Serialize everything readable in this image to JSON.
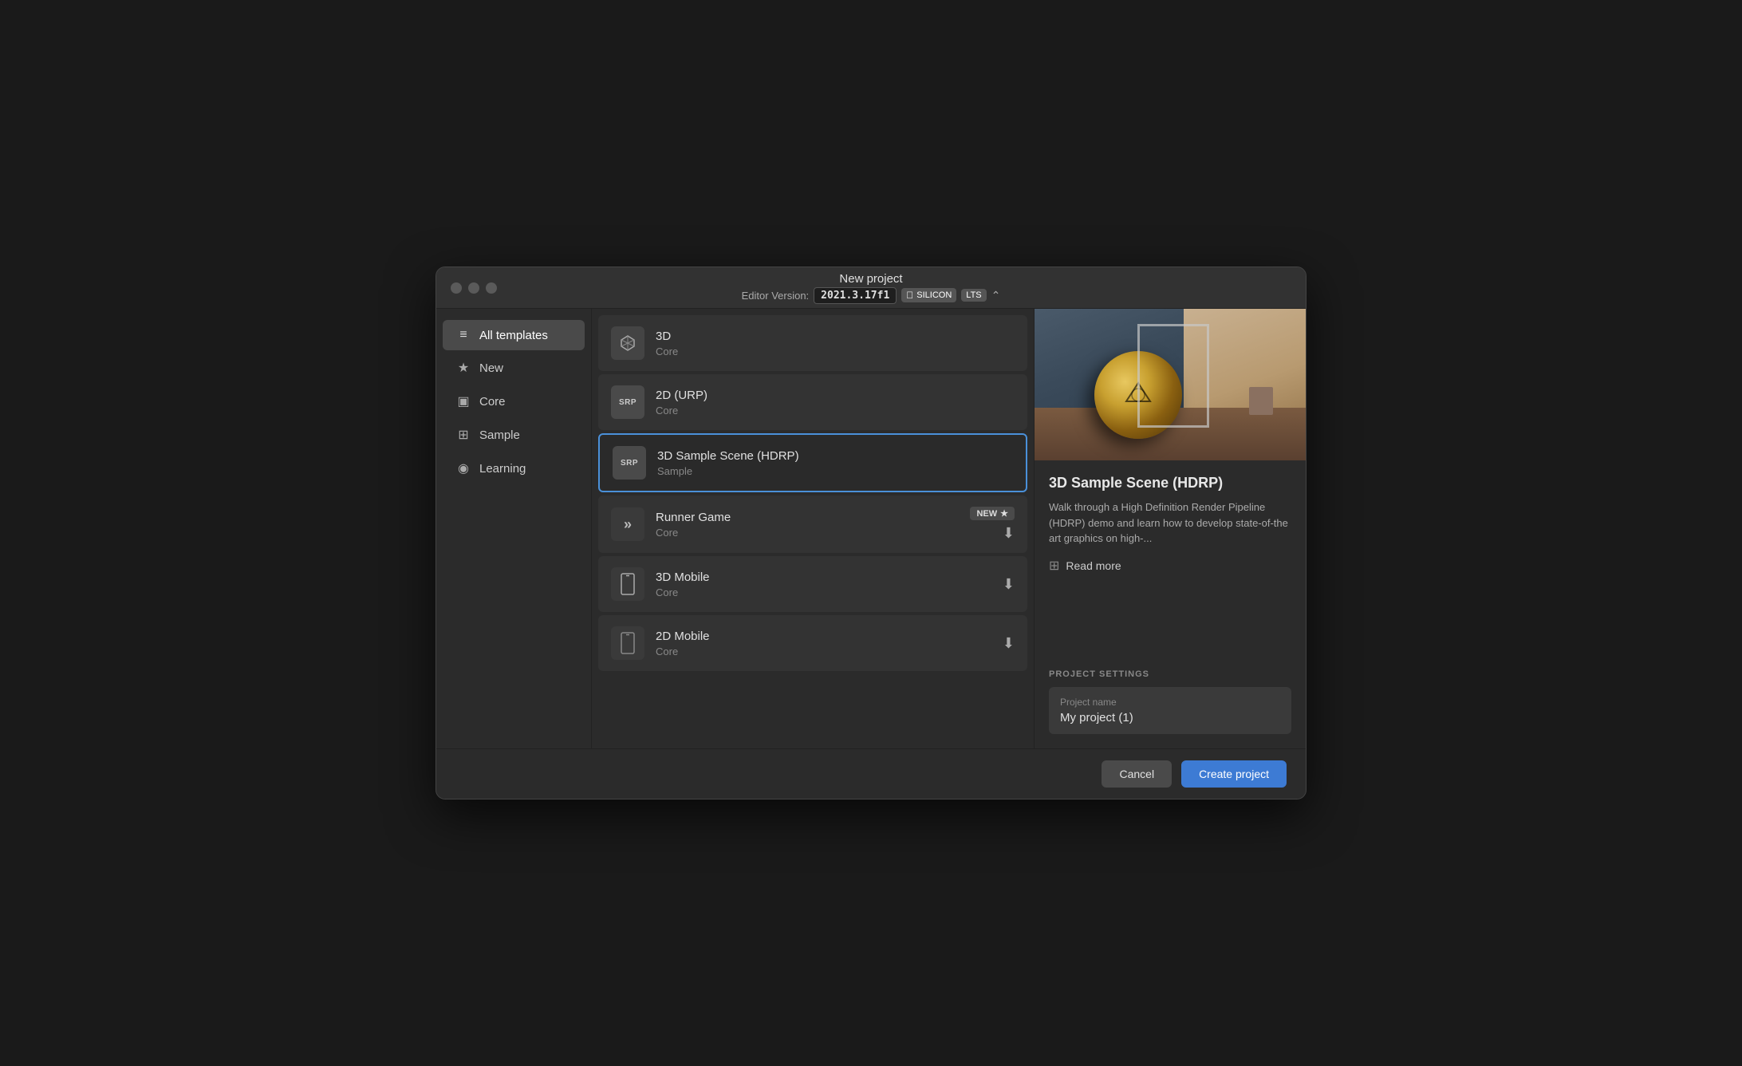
{
  "window": {
    "title": "New project"
  },
  "titlebar": {
    "title": "New project",
    "version_label": "Editor Version:",
    "version": "2021.3.17f1",
    "silicon": "SILICON",
    "lts": "LTS"
  },
  "sidebar": {
    "items": [
      {
        "id": "all-templates",
        "label": "All templates",
        "icon": "≡",
        "active": true
      },
      {
        "id": "new",
        "label": "New",
        "icon": "★"
      },
      {
        "id": "core",
        "label": "Core",
        "icon": "▣"
      },
      {
        "id": "sample",
        "label": "Sample",
        "icon": "⊞"
      },
      {
        "id": "learning",
        "label": "Learning",
        "icon": "◉"
      }
    ]
  },
  "templates": [
    {
      "id": "3d",
      "name": "3D",
      "category": "Core",
      "icon_type": "cube",
      "icon_label": "3D",
      "selected": false,
      "badge": null,
      "download": false
    },
    {
      "id": "2d-urp",
      "name": "2D (URP)",
      "category": "Core",
      "icon_type": "srp",
      "icon_label": "SRP",
      "selected": false,
      "badge": null,
      "download": false
    },
    {
      "id": "3d-hdrp",
      "name": "3D Sample Scene (HDRP)",
      "category": "Sample",
      "icon_type": "srp",
      "icon_label": "SRP",
      "selected": true,
      "badge": null,
      "download": false
    },
    {
      "id": "runner-game",
      "name": "Runner Game",
      "category": "Core",
      "icon_type": "runner",
      "icon_label": "»",
      "selected": false,
      "badge": "NEW",
      "download": true
    },
    {
      "id": "3d-mobile",
      "name": "3D Mobile",
      "category": "Core",
      "icon_type": "mobile",
      "icon_label": "📱",
      "selected": false,
      "badge": null,
      "download": true
    },
    {
      "id": "2d-mobile",
      "name": "2D Mobile",
      "category": "Core",
      "icon_type": "mobile2",
      "icon_label": "▭",
      "selected": false,
      "badge": null,
      "download": true
    }
  ],
  "detail": {
    "title": "3D Sample Scene (HDRP)",
    "description": "Walk through a High Definition Render Pipeline (HDRP) demo and learn how to develop state-of-the art graphics on high-...",
    "read_more_label": "Read more"
  },
  "project_settings": {
    "section_label": "PROJECT SETTINGS",
    "field_label": "Project name",
    "project_name": "My project (1)"
  },
  "footer": {
    "cancel_label": "Cancel",
    "create_label": "Create project"
  },
  "colors": {
    "accent_blue": "#3d7bd4",
    "selected_border": "#4a90d9"
  }
}
